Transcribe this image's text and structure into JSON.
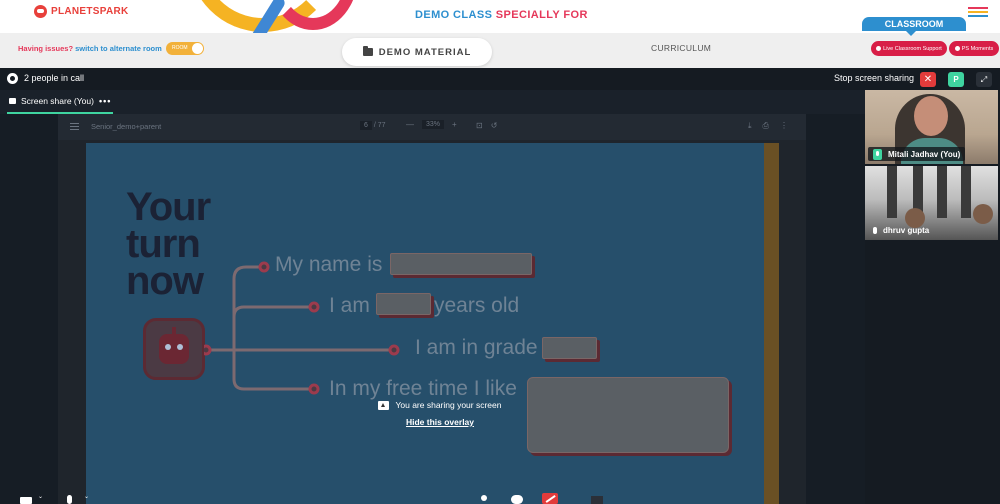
{
  "header": {
    "logo_text": "PLANETSPARK",
    "headline_part1": "DEMO CLASS ",
    "headline_part2": "SPECIALLY FOR",
    "classroom_tab": "CLASSROOM",
    "issues_text": "Having issues?",
    "alternate_room_link": "switch to alternate room",
    "toggle_label": "ROOM",
    "demo_material_button": "DEMO MATERIAL",
    "curriculum_label": "CURRICULUM",
    "live_support_button": "Live Classroom Support",
    "ps_moments_button": "PS Moments",
    "menu_colors": [
      "#e5385a",
      "#f5b323",
      "#2d8fcf"
    ]
  },
  "call": {
    "people_count": "2 people in call",
    "stop_sharing": "Stop screen sharing",
    "close_symbol": "✕",
    "avatar_letter": "P",
    "fullscreen_symbol": "⤢",
    "tab_label": "Screen share (You)",
    "tab_more": "•••"
  },
  "viewer": {
    "file_name": "Senior_demo+parent",
    "page_current": "6",
    "page_total": "/ 77",
    "zoom_minus": "—",
    "zoom_level": "33%",
    "zoom_plus": "+",
    "fit_icon": "⊡",
    "rotate_icon": "↺",
    "download_icon": "⤓",
    "print_icon": "⎙",
    "more_icon": "⋮"
  },
  "slide": {
    "title_line1": "Your",
    "title_line2": "turn",
    "title_line3": "now",
    "prompt1": "My name is",
    "prompt2_a": "I am",
    "prompt2_b": "years old",
    "prompt3": "I am in grade",
    "prompt4": "In my free time I like"
  },
  "overlay": {
    "sharing_text": "You are sharing your screen",
    "hide_link": "Hide this overlay"
  },
  "participants": [
    {
      "name": "Mitali Jadhav (You)",
      "mic": "on"
    },
    {
      "name": "dhruv gupta",
      "mic": "plain"
    }
  ],
  "colors": {
    "brand_red": "#e5385a",
    "brand_blue": "#2d8fcf",
    "meet_green": "#3fd4a0",
    "meet_red": "#e23b3b"
  }
}
